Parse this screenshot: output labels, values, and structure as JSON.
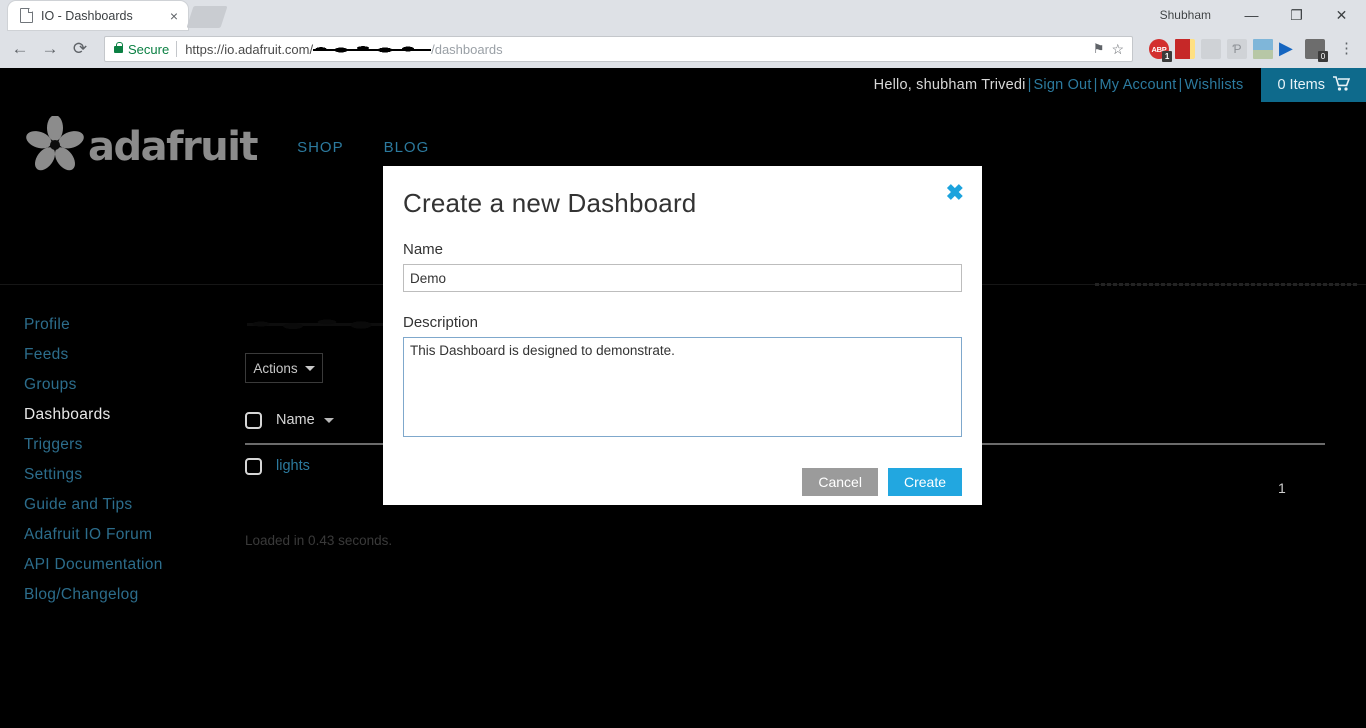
{
  "browser": {
    "tab": {
      "title": "IO - Dashboards",
      "favicon": "page-icon",
      "close": "×"
    },
    "new_tab_label": "",
    "window": {
      "profile_name": "Shubham",
      "minimize": "—",
      "maximize": "❐",
      "close": "✕"
    },
    "nav": {
      "back": "←",
      "forward": "→",
      "reload": "⟳"
    },
    "omnibox": {
      "security_label": "Secure",
      "url_prefix": "https://io.adafruit.com/",
      "url_redacted": "",
      "url_suffix": "/dashboards",
      "save_icon": "⚑",
      "bookmark_icon": "☆"
    },
    "extensions": [
      {
        "name": "adblock-plus-extension",
        "glyph": "ABP",
        "badge": "1"
      },
      {
        "name": "dictionary-extension",
        "glyph": "",
        "badge": ""
      },
      {
        "name": "screen-capture-extension",
        "glyph": "",
        "badge": ""
      },
      {
        "name": "adobe-pdf-extension",
        "glyph": "Ƥ",
        "badge": ""
      },
      {
        "name": "image-download-extension",
        "glyph": "",
        "badge": ""
      },
      {
        "name": "video-player-extension",
        "glyph": "▶",
        "badge": ""
      },
      {
        "name": "screenshot-extension",
        "glyph": "",
        "badge": "0"
      }
    ],
    "menu_icon": "⋮"
  },
  "site": {
    "topbar": {
      "greeting": "Hello, shubham Trivedi",
      "sign_out": "Sign Out",
      "my_account": "My Account",
      "wishlists": "Wishlists",
      "separator": "|",
      "cart_label": "0 Items",
      "cart_icon": "🛒",
      "cart_color": "#0e6a8c"
    },
    "masthead": {
      "logo_text": "adafruit",
      "logo_icon": "adafruit-flower-logo",
      "nav": [
        {
          "label": "SHOP"
        },
        {
          "label": "BLOG"
        }
      ]
    },
    "sidebar": {
      "items": [
        {
          "label": "Profile",
          "active": false
        },
        {
          "label": "Feeds",
          "active": false
        },
        {
          "label": "Groups",
          "active": false
        },
        {
          "label": "Dashboards",
          "active": true
        },
        {
          "label": "Triggers",
          "active": false
        },
        {
          "label": "Settings",
          "active": false
        },
        {
          "label": "Guide and Tips",
          "active": false
        },
        {
          "label": "Adafruit IO Forum",
          "active": false
        },
        {
          "label": "API Documentation",
          "active": false
        },
        {
          "label": "Blog/Changelog",
          "active": false
        }
      ]
    },
    "content": {
      "heading": "",
      "actions_button": "Actions",
      "table": {
        "columns": [
          "Name"
        ],
        "sort_column": "Name",
        "rows": [
          {
            "name": "lights"
          }
        ]
      },
      "pagination": {
        "current_page": "1"
      },
      "footer_note": "Loaded in 0.43 seconds."
    }
  },
  "modal": {
    "title": "Create a new Dashboard",
    "close_icon": "✖",
    "close_color": "#1ca3dd",
    "name": {
      "label": "Name",
      "value": "Demo",
      "placeholder": ""
    },
    "description": {
      "label": "Description",
      "value": "This Dashboard is designed to demonstrate.",
      "placeholder": ""
    },
    "cancel_label": "Cancel",
    "create_label": "Create",
    "cancel_color": "#9b9b9b",
    "create_color": "#22a7e0"
  }
}
